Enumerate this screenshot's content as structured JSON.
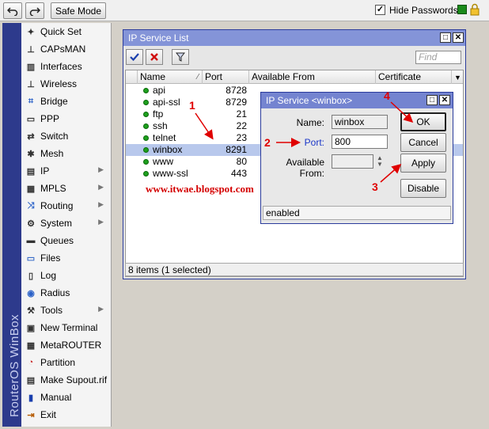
{
  "toolbar": {
    "undo_icon": "undo-arrow",
    "redo_icon": "redo-arrow",
    "safe_mode_label": "Safe Mode",
    "hide_passwords_label": "Hide Passwords",
    "hide_passwords_checked": true
  },
  "brand": "RouterOS WinBox",
  "sidebar": {
    "items": [
      {
        "label": "Quick Set",
        "icon": "wand-icon",
        "submenu": false
      },
      {
        "label": "CAPsMAN",
        "icon": "antenna-icon",
        "submenu": false
      },
      {
        "label": "Interfaces",
        "icon": "ports-icon",
        "submenu": false
      },
      {
        "label": "Wireless",
        "icon": "antenna-icon",
        "submenu": false
      },
      {
        "label": "Bridge",
        "icon": "bridge-icon",
        "submenu": false
      },
      {
        "label": "PPP",
        "icon": "ppp-icon",
        "submenu": false
      },
      {
        "label": "Switch",
        "icon": "switch-icon",
        "submenu": false
      },
      {
        "label": "Mesh",
        "icon": "mesh-icon",
        "submenu": false
      },
      {
        "label": "IP",
        "icon": "ip-icon",
        "submenu": true
      },
      {
        "label": "MPLS",
        "icon": "mpls-icon",
        "submenu": true
      },
      {
        "label": "Routing",
        "icon": "routing-icon",
        "submenu": true
      },
      {
        "label": "System",
        "icon": "gear-icon",
        "submenu": true
      },
      {
        "label": "Queues",
        "icon": "queues-icon",
        "submenu": false
      },
      {
        "label": "Files",
        "icon": "folder-icon",
        "submenu": false
      },
      {
        "label": "Log",
        "icon": "log-icon",
        "submenu": false
      },
      {
        "label": "Radius",
        "icon": "radius-icon",
        "submenu": false
      },
      {
        "label": "Tools",
        "icon": "tools-icon",
        "submenu": true
      },
      {
        "label": "New Terminal",
        "icon": "terminal-icon",
        "submenu": false
      },
      {
        "label": "MetaROUTER",
        "icon": "metarouter-icon",
        "submenu": false
      },
      {
        "label": "Partition",
        "icon": "partition-icon",
        "submenu": false
      },
      {
        "label": "Make Supout.rif",
        "icon": "supout-icon",
        "submenu": false
      },
      {
        "label": "Manual",
        "icon": "manual-icon",
        "submenu": false
      },
      {
        "label": "Exit",
        "icon": "exit-icon",
        "submenu": false
      }
    ]
  },
  "service_list": {
    "title": "IP Service List",
    "find_placeholder": "Find",
    "columns": {
      "name": "Name",
      "port": "Port",
      "available_from": "Available From",
      "certificate": "Certificate"
    },
    "rows": [
      {
        "name": "api",
        "port": "8728",
        "selected": false
      },
      {
        "name": "api-ssl",
        "port": "8729",
        "selected": false
      },
      {
        "name": "ftp",
        "port": "21",
        "selected": false
      },
      {
        "name": "ssh",
        "port": "22",
        "selected": false
      },
      {
        "name": "telnet",
        "port": "23",
        "selected": false
      },
      {
        "name": "winbox",
        "port": "8291",
        "selected": true
      },
      {
        "name": "www",
        "port": "80",
        "selected": false
      },
      {
        "name": "www-ssl",
        "port": "443",
        "selected": false
      }
    ],
    "status": "8 items (1 selected)"
  },
  "service_dialog": {
    "title": "IP Service <winbox>",
    "name_label": "Name:",
    "name_value": "winbox",
    "port_label": "Port:",
    "port_value": "800",
    "available_from_label": "Available From:",
    "available_from_value": "",
    "ok_label": "OK",
    "cancel_label": "Cancel",
    "apply_label": "Apply",
    "disable_label": "Disable",
    "status": "enabled"
  },
  "annotations": {
    "watermark": "www.itwae.blogspot.com",
    "step1": "1",
    "step2": "2",
    "step3": "3",
    "step4": "4",
    "arrow_color": "#e00000"
  },
  "colors": {
    "window_title_bg": "#8494d8",
    "brand_strip": "#2d3a8c",
    "selection": "#b8c8ec",
    "status_dot": "#1ea01e"
  }
}
